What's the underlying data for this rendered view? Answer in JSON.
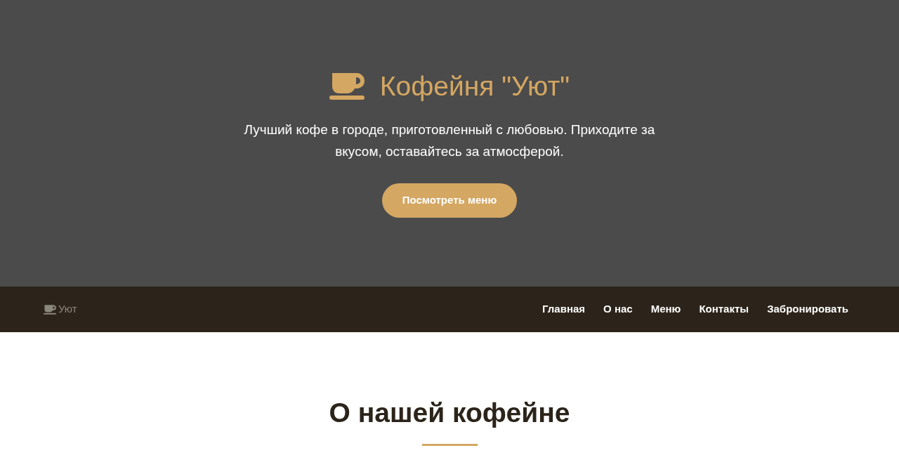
{
  "hero": {
    "title": "Кофейня \"Уют\"",
    "text": "Лучший кофе в городе, приготовленный с любовью. Приходите за вкусом, оставайтесь за атмосферой.",
    "button": "Посмотреть меню"
  },
  "navbar": {
    "logo": "Уют",
    "links": [
      "Главная",
      "О нас",
      "Меню",
      "Контакты",
      "Забронировать"
    ]
  },
  "about": {
    "title": "О нашей кофейне"
  }
}
